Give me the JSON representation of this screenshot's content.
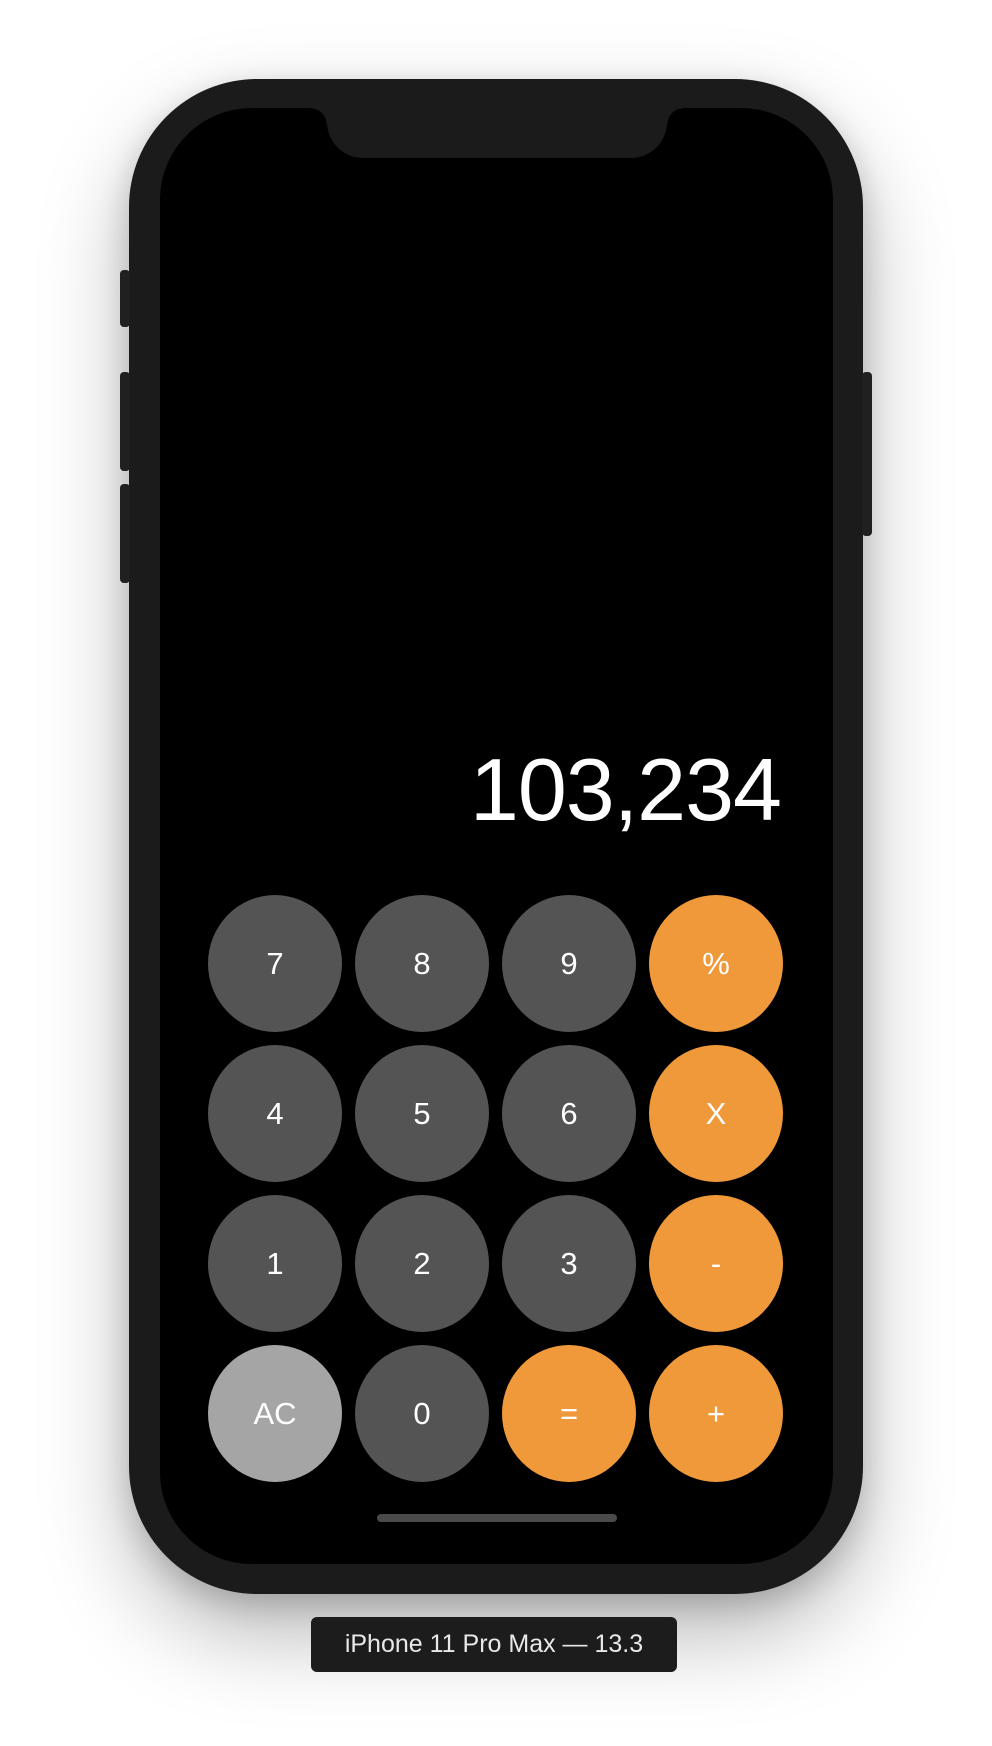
{
  "simulator": {
    "device_label": "iPhone 11 Pro Max — 13.3"
  },
  "calculator": {
    "display_value": "103,234",
    "keys": [
      {
        "label": "7",
        "kind": "number"
      },
      {
        "label": "8",
        "kind": "number"
      },
      {
        "label": "9",
        "kind": "number"
      },
      {
        "label": "%",
        "kind": "operator"
      },
      {
        "label": "4",
        "kind": "number"
      },
      {
        "label": "5",
        "kind": "number"
      },
      {
        "label": "6",
        "kind": "number"
      },
      {
        "label": "X",
        "kind": "operator"
      },
      {
        "label": "1",
        "kind": "number"
      },
      {
        "label": "2",
        "kind": "number"
      },
      {
        "label": "3",
        "kind": "number"
      },
      {
        "label": "-",
        "kind": "operator"
      },
      {
        "label": "AC",
        "kind": "function"
      },
      {
        "label": "0",
        "kind": "number"
      },
      {
        "label": "=",
        "kind": "operator"
      },
      {
        "label": "+",
        "kind": "operator"
      }
    ]
  },
  "colors": {
    "number_key": "#545454",
    "operator_key": "#f0993a",
    "function_key": "#a5a5a5",
    "screen_background": "#000000",
    "device_frame": "#1b1b1b"
  }
}
